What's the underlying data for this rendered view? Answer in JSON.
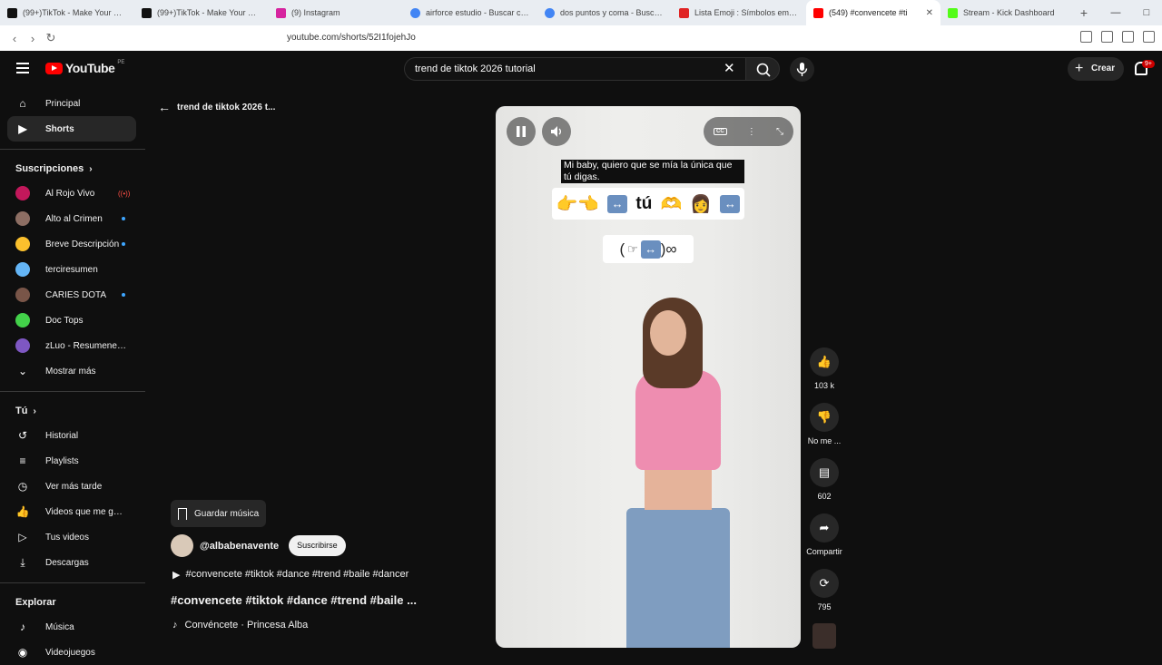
{
  "browser": {
    "tabs": [
      {
        "title": "(99+)TikTok - Make Your Day",
        "color": "#111111"
      },
      {
        "title": "(99+)TikTok - Make Your Day",
        "color": "#111111"
      },
      {
        "title": "(9) Instagram",
        "color": "#d6249f"
      },
      {
        "title": "airforce estudio - Buscar con G",
        "color": "#4285f4"
      },
      {
        "title": "dos puntos y coma - Buscar co",
        "color": "#4285f4"
      },
      {
        "title": "Lista Emoji : Símbolos emoji n",
        "color": "#e02424"
      },
      {
        "title": "(549) #convencete #ti",
        "color": "#ff0000"
      },
      {
        "title": "Stream - Kick Dashboard",
        "color": "#53fc18"
      }
    ],
    "url": "youtube.com/shorts/52I1fojehJo"
  },
  "header": {
    "logo_text": "YouTube",
    "country": "PE",
    "search_value": "trend de tiktok 2026 tutorial",
    "create_label": "Crear",
    "notif_badge": "9+"
  },
  "sidebar": {
    "main": [
      {
        "label": "Principal",
        "icon": "home-icon"
      },
      {
        "label": "Shorts",
        "icon": "shorts-icon"
      }
    ],
    "subs_heading": "Suscripciones",
    "subscriptions": [
      {
        "label": "Al Rojo Vivo",
        "color": "#c2185b",
        "indicator": "live"
      },
      {
        "label": "Alto al Crimen",
        "color": "#8d6e63",
        "indicator": "dot"
      },
      {
        "label": "Breve Descripción",
        "color": "#fbc02d",
        "indicator": "dot"
      },
      {
        "label": "terciresumen",
        "color": "#64b5f6",
        "indicator": ""
      },
      {
        "label": "CARIES DOTA",
        "color": "#795548",
        "indicator": "dot"
      },
      {
        "label": "Doc Tops",
        "color": "#43d14a",
        "indicator": ""
      },
      {
        "label": "zLuo - Resumenes ...",
        "color": "#7e57c2",
        "indicator": ""
      }
    ],
    "show_more": "Mostrar más",
    "you_heading": "Tú",
    "you_items": [
      {
        "label": "Historial",
        "icon": "history-icon"
      },
      {
        "label": "Playlists",
        "icon": "playlist-icon"
      },
      {
        "label": "Ver más tarde",
        "icon": "watch-later-icon"
      },
      {
        "label": "Videos que me gus...",
        "icon": "like-icon"
      },
      {
        "label": "Tus videos",
        "icon": "your-videos-icon"
      },
      {
        "label": "Descargas",
        "icon": "download-icon"
      }
    ],
    "explore_heading": "Explorar",
    "explore_items": [
      {
        "label": "Música",
        "icon": "music-icon"
      },
      {
        "label": "Videojuegos",
        "icon": "gaming-icon"
      }
    ]
  },
  "content": {
    "back_title": "trend de tiktok 2026 t...",
    "save_music": "Guardar música",
    "channel": "@albabenavente",
    "subscribe": "Suscribirse",
    "tags": "#convencete #tiktok #dance #trend #baile #dancer",
    "title": "#convencete #tiktok #dance #trend #baile ...",
    "music": "Convéncete · Princesa Alba"
  },
  "video": {
    "caption_line1": "Mi baby, quiero que se mía la única que",
    "caption_line2": "tú digas.",
    "emoji_word": "tú"
  },
  "rail": [
    {
      "label": "103 k",
      "icon": "thumbs-up-icon"
    },
    {
      "label": "No me ...",
      "icon": "thumbs-down-icon"
    },
    {
      "label": "602",
      "icon": "comment-icon"
    },
    {
      "label": "Compartir",
      "icon": "share-icon"
    },
    {
      "label": "795",
      "icon": "remix-icon"
    }
  ]
}
